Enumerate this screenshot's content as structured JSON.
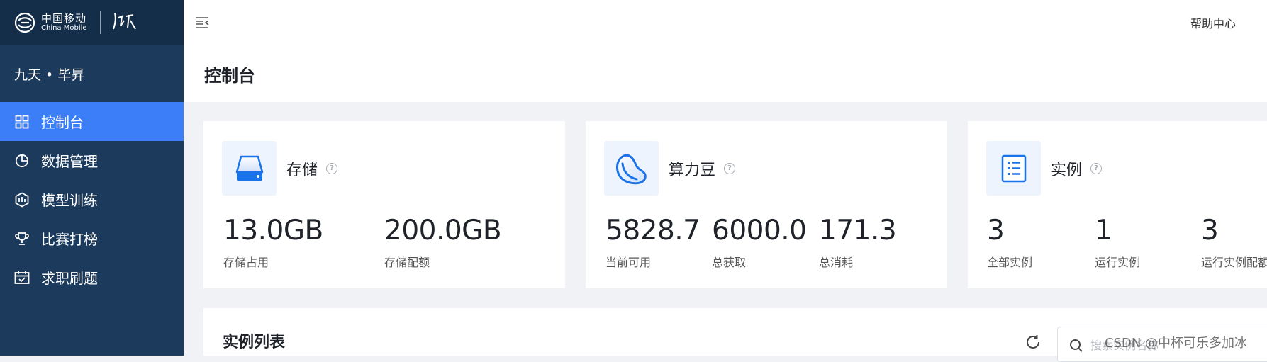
{
  "logo": {
    "zh": "中国移动",
    "en": "China Mobile",
    "brand": "九天"
  },
  "header": {
    "help": "帮助中心"
  },
  "sidebar": {
    "project": "九天 • 毕昇",
    "items": [
      {
        "label": "控制台",
        "icon": "dashboard-grid-icon",
        "active": true
      },
      {
        "label": "数据管理",
        "icon": "pie-chart-icon",
        "active": false
      },
      {
        "label": "模型训练",
        "icon": "model-hexagon-icon",
        "active": false
      },
      {
        "label": "比赛打榜",
        "icon": "trophy-icon",
        "active": false
      },
      {
        "label": "求职刷题",
        "icon": "calendar-check-icon",
        "active": false
      }
    ]
  },
  "page": {
    "title": "控制台"
  },
  "cards": [
    {
      "title": "存储",
      "icon": "storage-drive-icon",
      "metrics": [
        {
          "value": "13.0GB",
          "label": "存储占用"
        },
        {
          "value": "200.0GB",
          "label": "存储配额"
        }
      ]
    },
    {
      "title": "算力豆",
      "icon": "bean-icon",
      "metrics": [
        {
          "value": "5828.7",
          "label": "当前可用"
        },
        {
          "value": "6000.0",
          "label": "总获取"
        },
        {
          "value": "171.3",
          "label": "总消耗"
        }
      ]
    },
    {
      "title": "实例",
      "icon": "instance-list-icon",
      "metrics": [
        {
          "value": "3",
          "label": "全部实例"
        },
        {
          "value": "1",
          "label": "运行实例"
        },
        {
          "value": "3",
          "label": "运行实例配额"
        }
      ]
    }
  ],
  "instance_list": {
    "title": "实例列表",
    "search_placeholder": "搜索实例名称"
  },
  "watermark": "CSDN @中杯可乐多加冰",
  "colors": {
    "sidebar": "#1b3a5c",
    "sidebar_logo": "#142d49",
    "active": "#3b7ef8",
    "accent": "#1a73e8",
    "background": "#f0f2f5"
  }
}
